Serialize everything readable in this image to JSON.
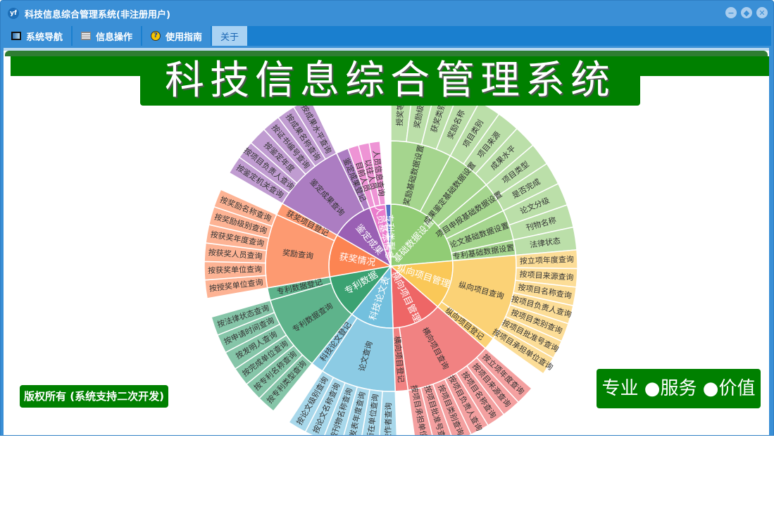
{
  "window": {
    "title": "科技信息综合管理系统(非注册用户)",
    "icon": "app-logo-icon",
    "logo_text": "yf"
  },
  "controls": {
    "minimize": "−",
    "restore": "◆",
    "close": "✕"
  },
  "tabs": [
    {
      "label": "系统导航",
      "icon": "monitor-icon"
    },
    {
      "label": "信息操作",
      "icon": "grid-icon"
    },
    {
      "label": "使用指南",
      "icon": "help-icon",
      "glyph": "?"
    },
    {
      "label": "关于",
      "active": true
    }
  ],
  "banner": {
    "title": "科技信息综合管理系统"
  },
  "footer": {
    "copyright": "版权所有 (系统支持二次开发)",
    "slogan": "专业 ●服务 ●价值"
  },
  "chart_data": {
    "type": "sunburst",
    "nodes": [
      {
        "name": "基础数据设置",
        "value": 85,
        "color": "#91cc75",
        "children": [
          {
            "name": "奖励基础数据设置",
            "children": [
              {
                "name": "授奖等级"
              },
              {
                "name": "奖励级别"
              },
              {
                "name": "获奖类别"
              },
              {
                "name": "奖励名称"
              }
            ]
          },
          {
            "name": "成果鉴定基础数据设置",
            "children": [
              {
                "name": "项目类别"
              },
              {
                "name": "项目来源"
              },
              {
                "name": "成果水平"
              }
            ]
          },
          {
            "name": "项目申报基础数据设置",
            "children": [
              {
                "name": "项目类型"
              },
              {
                "name": "是否完成"
              }
            ]
          },
          {
            "name": "论文基础数据设置",
            "children": [
              {
                "name": "论文分级"
              },
              {
                "name": "刊物名称"
              }
            ]
          },
          {
            "name": "专利基础数据设置",
            "children": [
              {
                "name": "法律状态"
              }
            ]
          }
        ]
      },
      {
        "name": "纵向项目管理",
        "value": 46,
        "color": "#fac858",
        "children": [
          {
            "name": "纵向项目查询",
            "children": [
              {
                "name": "按立项年度查询"
              },
              {
                "name": "按项目来源查询"
              },
              {
                "name": "按项目名称查询"
              },
              {
                "name": "按项目负责人查询"
              },
              {
                "name": "按项目类别查询"
              },
              {
                "name": "按项目批准号查询"
              },
              {
                "name": "按项目承担单位查询"
              }
            ]
          },
          {
            "name": "纵向项目登记"
          }
        ]
      },
      {
        "name": "横向项目管理",
        "value": 47,
        "color": "#ee6666",
        "children": [
          {
            "name": "横向项目查询",
            "children": [
              {
                "name": "按立项年度查询"
              },
              {
                "name": "按项目来源查询"
              },
              {
                "name": "按项目名称查询"
              },
              {
                "name": "按项目负责人查询"
              },
              {
                "name": "按项目类别查询"
              },
              {
                "name": "按项目批准号查询"
              },
              {
                "name": "按项目承担单位查询"
              }
            ]
          },
          {
            "name": "横向项目登记"
          }
        ]
      },
      {
        "name": "科技论文表",
        "value": 41,
        "color": "#73c0de",
        "children": [
          {
            "name": "论文查询",
            "children": [
              {
                "name": "按作者查询"
              },
              {
                "name": "按所在单位查询"
              },
              {
                "name": "按发表年度查询"
              },
              {
                "name": "按刊物名称查询"
              },
              {
                "name": "按论文名称查询"
              },
              {
                "name": "按论文级别查询"
              }
            ]
          },
          {
            "name": "科技论文登记"
          }
        ]
      },
      {
        "name": "专利数据",
        "value": 41,
        "color": "#3ba272",
        "children": [
          {
            "name": "专利数据查询",
            "children": [
              {
                "name": "按专利类型查询"
              },
              {
                "name": "按专利名称查询"
              },
              {
                "name": "按完成单位查询"
              },
              {
                "name": "按发明人查询"
              },
              {
                "name": "按申请时间查询"
              },
              {
                "name": "按法律状态查询"
              }
            ]
          },
          {
            "name": "专利数据登记"
          }
        ]
      },
      {
        "name": "获奖情况",
        "value": 40,
        "color": "#fc8452",
        "children": [
          {
            "name": "奖励查询",
            "children": [
              {
                "name": "按授奖单位查询"
              },
              {
                "name": "按获奖单位查询"
              },
              {
                "name": "按获奖人员查询"
              },
              {
                "name": "按获奖年度查询"
              },
              {
                "name": "按奖励级别查询"
              },
              {
                "name": "按奖励名称查询"
              }
            ]
          },
          {
            "name": "获奖项目登记"
          }
        ]
      },
      {
        "name": "鉴定成果",
        "value": 40,
        "color": "#9a60b4",
        "children": [
          {
            "name": "鉴定成果查询",
            "children": [
              {
                "name": "按鉴定机关查询"
              },
              {
                "name": "按项目负责人查询"
              },
              {
                "name": "按鉴定年度"
              },
              {
                "name": "按证书编号查询"
              },
              {
                "name": "按成果名称查询"
              },
              {
                "name": "按成果水平查询"
              }
            ]
          },
          {
            "name": "鉴定成果登记"
          }
        ]
      },
      {
        "name": "人员基本信息",
        "value": 15,
        "color": "#ea7ccc",
        "children": [
          {
            "name": "目前人员"
          },
          {
            "name": "以往人员"
          },
          {
            "name": "人员信息查询"
          }
        ]
      },
      {
        "name": "专利类型",
        "value": 5,
        "color": "#5470c6"
      }
    ]
  }
}
